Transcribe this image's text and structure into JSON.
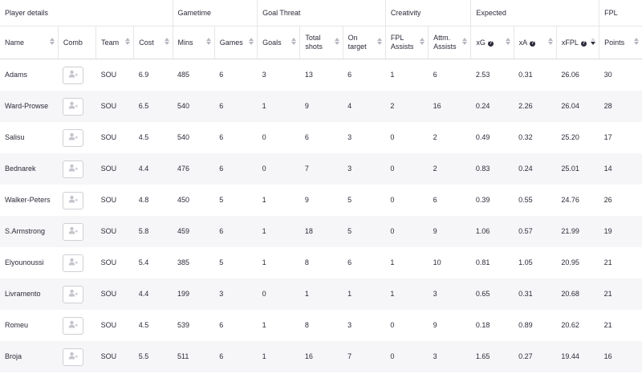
{
  "groups": {
    "player_details": "Player details",
    "gametime": "Gametime",
    "goal_threat": "Goal Threat",
    "creativity": "Creativity",
    "expected": "Expected",
    "fpl": "FPL"
  },
  "columns": {
    "name": "Name",
    "comb": "Comb",
    "team": "Team",
    "cost": "Cost",
    "mins": "Mins",
    "games": "Games",
    "goals": "Goals",
    "total_shots_1": "Total",
    "total_shots_2": "shots",
    "on_target_1": "On",
    "on_target_2": "target",
    "fpl_assists_1": "FPL",
    "fpl_assists_2": "Assists",
    "attm_assists_1": "Attm.",
    "attm_assists_2": "Assists",
    "xg": "xG",
    "xa": "xA",
    "xfpl": "xFPL",
    "points": "Points"
  },
  "help_glyph": "?",
  "rows": [
    {
      "name": "Adams",
      "team": "SOU",
      "cost": "6.9",
      "mins": "485",
      "games": "6",
      "goals": "3",
      "shots": "13",
      "on_target": "6",
      "fpl_assists": "1",
      "attm_assists": "6",
      "xg": "2.53",
      "xa": "0.31",
      "xfpl": "26.06",
      "points": "30"
    },
    {
      "name": "Ward-Prowse",
      "team": "SOU",
      "cost": "6.5",
      "mins": "540",
      "games": "6",
      "goals": "1",
      "shots": "9",
      "on_target": "4",
      "fpl_assists": "2",
      "attm_assists": "16",
      "xg": "0.24",
      "xa": "2.26",
      "xfpl": "26.04",
      "points": "28"
    },
    {
      "name": "Salisu",
      "team": "SOU",
      "cost": "4.5",
      "mins": "540",
      "games": "6",
      "goals": "0",
      "shots": "6",
      "on_target": "3",
      "fpl_assists": "0",
      "attm_assists": "2",
      "xg": "0.49",
      "xa": "0.32",
      "xfpl": "25.20",
      "points": "17"
    },
    {
      "name": "Bednarek",
      "team": "SOU",
      "cost": "4.4",
      "mins": "476",
      "games": "6",
      "goals": "0",
      "shots": "7",
      "on_target": "3",
      "fpl_assists": "0",
      "attm_assists": "2",
      "xg": "0.83",
      "xa": "0.24",
      "xfpl": "25.01",
      "points": "14"
    },
    {
      "name": "Walker-Peters",
      "team": "SOU",
      "cost": "4.8",
      "mins": "450",
      "games": "5",
      "goals": "1",
      "shots": "9",
      "on_target": "5",
      "fpl_assists": "0",
      "attm_assists": "6",
      "xg": "0.39",
      "xa": "0.55",
      "xfpl": "24.76",
      "points": "26"
    },
    {
      "name": "S.Armstrong",
      "team": "SOU",
      "cost": "5.8",
      "mins": "459",
      "games": "6",
      "goals": "1",
      "shots": "18",
      "on_target": "5",
      "fpl_assists": "0",
      "attm_assists": "9",
      "xg": "1.06",
      "xa": "0.57",
      "xfpl": "21.99",
      "points": "19"
    },
    {
      "name": "Elyounoussi",
      "team": "SOU",
      "cost": "5.4",
      "mins": "385",
      "games": "5",
      "goals": "1",
      "shots": "8",
      "on_target": "6",
      "fpl_assists": "1",
      "attm_assists": "10",
      "xg": "0.81",
      "xa": "1.05",
      "xfpl": "20.95",
      "points": "21"
    },
    {
      "name": "Livramento",
      "team": "SOU",
      "cost": "4.4",
      "mins": "199",
      "games": "3",
      "goals": "0",
      "shots": "1",
      "on_target": "1",
      "fpl_assists": "1",
      "attm_assists": "3",
      "xg": "0.65",
      "xa": "0.31",
      "xfpl": "20.68",
      "points": "21"
    },
    {
      "name": "Romeu",
      "team": "SOU",
      "cost": "4.5",
      "mins": "539",
      "games": "6",
      "goals": "1",
      "shots": "8",
      "on_target": "3",
      "fpl_assists": "0",
      "attm_assists": "9",
      "xg": "0.18",
      "xa": "0.89",
      "xfpl": "20.62",
      "points": "21"
    },
    {
      "name": "Broja",
      "team": "SOU",
      "cost": "5.5",
      "mins": "511",
      "games": "6",
      "goals": "1",
      "shots": "16",
      "on_target": "7",
      "fpl_assists": "0",
      "attm_assists": "3",
      "xg": "1.65",
      "xa": "0.27",
      "xfpl": "19.44",
      "points": "16"
    }
  ]
}
